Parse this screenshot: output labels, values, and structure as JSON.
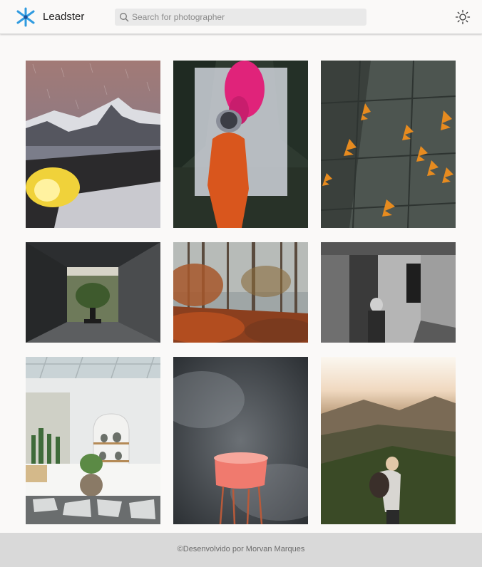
{
  "header": {
    "brand": "Leadster",
    "search_placeholder": "Search for photographer"
  },
  "colors": {
    "accent": "#2f9be0",
    "header_bg": "#faf9f8",
    "footer_bg": "#d9d9d9"
  },
  "icons": {
    "logo": "leadster-star-icon",
    "search": "search-icon",
    "theme": "sun-icon"
  },
  "gallery": {
    "photos": [
      {
        "subject": "mountain-tent-night"
      },
      {
        "subject": "astronaut-pink-smoke"
      },
      {
        "subject": "autumn-leaves-pavement"
      },
      {
        "subject": "concrete-tunnel-garden"
      },
      {
        "subject": "autumn-forest-fog"
      },
      {
        "subject": "black-white-old-building"
      },
      {
        "subject": "white-patio-cactus-shelves"
      },
      {
        "subject": "pink-chair-smoke"
      },
      {
        "subject": "hiker-sunset-mountain"
      }
    ]
  },
  "footer": {
    "copyright_symbol": "©",
    "text": "Desenvolvido por Morvan Marques"
  }
}
